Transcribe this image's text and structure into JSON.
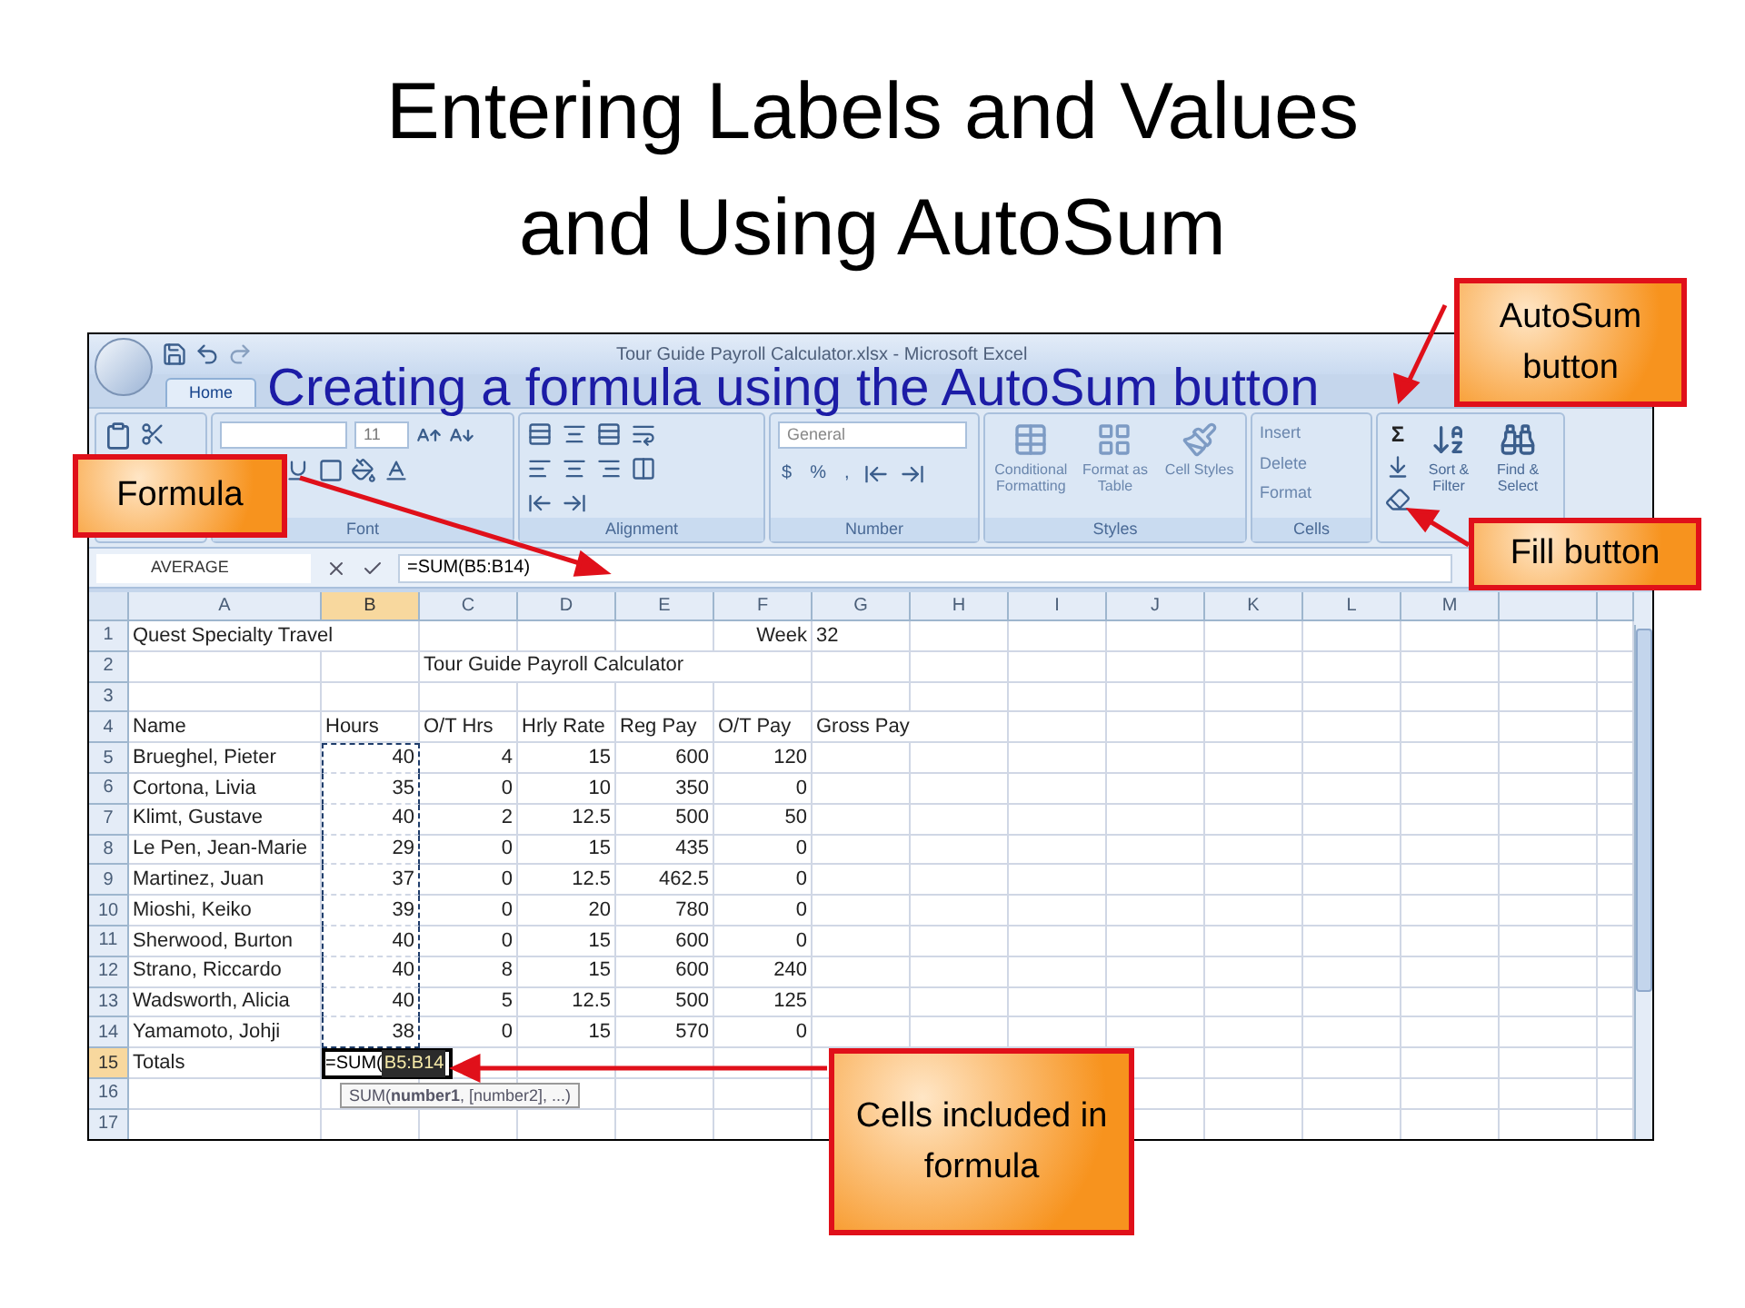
{
  "slide": {
    "title": "Entering Labels and Values\nand Using AutoSum",
    "subtitle": "Creating a formula using the AutoSum button"
  },
  "window": {
    "title": "Tour Guide Payroll Calculator.xlsx - Microsoft Excel"
  },
  "ribbon_tabs": [
    {
      "label": "Home",
      "selected": true
    }
  ],
  "ribbon": {
    "font": {
      "label": "Font",
      "size": "11"
    },
    "alignment": {
      "label": "Alignment"
    },
    "number": {
      "label": "Number",
      "format": "General",
      "buttons": [
        "$",
        "%",
        ","
      ]
    },
    "styles": {
      "label": "Styles",
      "buttons": [
        "Conditional Formatting",
        "Format as Table",
        "Cell Styles"
      ]
    },
    "cells": {
      "label": "Cells",
      "buttons": [
        "Insert",
        "Delete",
        "Format"
      ]
    },
    "editing": {
      "autosum": "Σ",
      "buttons": [
        "Sort & Filter",
        "Find & Select"
      ]
    }
  },
  "formula_bar": {
    "name_box": "AVERAGE",
    "formula": "=SUM(B5:B14)"
  },
  "sheet": {
    "columns": [
      {
        "label": "A",
        "selected": false
      },
      {
        "label": "B",
        "selected": true
      },
      {
        "label": "C",
        "selected": false
      },
      {
        "label": "D",
        "selected": false
      },
      {
        "label": "E",
        "selected": false
      },
      {
        "label": "F",
        "selected": false
      },
      {
        "label": "G",
        "selected": false
      },
      {
        "label": "H",
        "selected": false
      },
      {
        "label": "I",
        "selected": false
      },
      {
        "label": "J",
        "selected": false
      },
      {
        "label": "K",
        "selected": false
      },
      {
        "label": "L",
        "selected": false
      },
      {
        "label": "M",
        "selected": false
      }
    ],
    "rows": [
      {
        "label": "1",
        "selected": false,
        "cells": [
          {
            "text": "Quest Specialty Travel"
          },
          {},
          {},
          {},
          {},
          {
            "text": "Week",
            "kind": "right"
          },
          {
            "text": "32"
          }
        ]
      },
      {
        "label": "2",
        "selected": false,
        "cells": [
          {},
          {},
          {
            "text": "Tour Guide Payroll Calculator"
          }
        ]
      },
      {
        "label": "3",
        "selected": false,
        "cells": []
      },
      {
        "label": "4",
        "selected": false,
        "cells": [
          {
            "text": "Name"
          },
          {
            "text": "Hours"
          },
          {
            "text": "O/T Hrs"
          },
          {
            "text": "Hrly Rate"
          },
          {
            "text": "Reg Pay"
          },
          {
            "text": "O/T Pay"
          },
          {
            "text": "Gross Pay"
          }
        ]
      },
      {
        "label": "5",
        "selected": false,
        "cells": [
          {
            "text": "Brueghel, Pieter"
          },
          {
            "text": "40",
            "kind": "right",
            "marked": true
          },
          {
            "text": "4",
            "kind": "right"
          },
          {
            "text": "15",
            "kind": "right"
          },
          {
            "text": "600",
            "kind": "right"
          },
          {
            "text": "120",
            "kind": "right"
          }
        ]
      },
      {
        "label": "6",
        "selected": false,
        "cells": [
          {
            "text": "Cortona, Livia"
          },
          {
            "text": "35",
            "kind": "right",
            "marked": true
          },
          {
            "text": "0",
            "kind": "right"
          },
          {
            "text": "10",
            "kind": "right"
          },
          {
            "text": "350",
            "kind": "right"
          },
          {
            "text": "0",
            "kind": "right"
          }
        ]
      },
      {
        "label": "7",
        "selected": false,
        "cells": [
          {
            "text": "Klimt, Gustave"
          },
          {
            "text": "40",
            "kind": "right",
            "marked": true
          },
          {
            "text": "2",
            "kind": "right"
          },
          {
            "text": "12.5",
            "kind": "right"
          },
          {
            "text": "500",
            "kind": "right"
          },
          {
            "text": "50",
            "kind": "right"
          }
        ]
      },
      {
        "label": "8",
        "selected": false,
        "cells": [
          {
            "text": "Le Pen, Jean-Marie"
          },
          {
            "text": "29",
            "kind": "right",
            "marked": true
          },
          {
            "text": "0",
            "kind": "right"
          },
          {
            "text": "15",
            "kind": "right"
          },
          {
            "text": "435",
            "kind": "right"
          },
          {
            "text": "0",
            "kind": "right"
          }
        ]
      },
      {
        "label": "9",
        "selected": false,
        "cells": [
          {
            "text": "Martinez, Juan"
          },
          {
            "text": "37",
            "kind": "right",
            "marked": true
          },
          {
            "text": "0",
            "kind": "right"
          },
          {
            "text": "12.5",
            "kind": "right"
          },
          {
            "text": "462.5",
            "kind": "right"
          },
          {
            "text": "0",
            "kind": "right"
          }
        ]
      },
      {
        "label": "10",
        "selected": false,
        "cells": [
          {
            "text": "Mioshi, Keiko"
          },
          {
            "text": "39",
            "kind": "right",
            "marked": true
          },
          {
            "text": "0",
            "kind": "right"
          },
          {
            "text": "20",
            "kind": "right"
          },
          {
            "text": "780",
            "kind": "right"
          },
          {
            "text": "0",
            "kind": "right"
          }
        ]
      },
      {
        "label": "11",
        "selected": false,
        "cells": [
          {
            "text": "Sherwood, Burton"
          },
          {
            "text": "40",
            "kind": "right",
            "marked": true
          },
          {
            "text": "0",
            "kind": "right"
          },
          {
            "text": "15",
            "kind": "right"
          },
          {
            "text": "600",
            "kind": "right"
          },
          {
            "text": "0",
            "kind": "right"
          }
        ]
      },
      {
        "label": "12",
        "selected": false,
        "cells": [
          {
            "text": "Strano, Riccardo"
          },
          {
            "text": "40",
            "kind": "right",
            "marked": true
          },
          {
            "text": "8",
            "kind": "right"
          },
          {
            "text": "15",
            "kind": "right"
          },
          {
            "text": "600",
            "kind": "right"
          },
          {
            "text": "240",
            "kind": "right"
          }
        ]
      },
      {
        "label": "13",
        "selected": false,
        "cells": [
          {
            "text": "Wadsworth, Alicia"
          },
          {
            "text": "40",
            "kind": "right",
            "marked": true
          },
          {
            "text": "5",
            "kind": "right"
          },
          {
            "text": "12.5",
            "kind": "right"
          },
          {
            "text": "500",
            "kind": "right"
          },
          {
            "text": "125",
            "kind": "right"
          }
        ]
      },
      {
        "label": "14",
        "selected": false,
        "cells": [
          {
            "text": "Yamamoto, Johji"
          },
          {
            "text": "38",
            "kind": "right",
            "marked": true
          },
          {
            "text": "0",
            "kind": "right"
          },
          {
            "text": "15",
            "kind": "right"
          },
          {
            "text": "570",
            "kind": "right"
          },
          {
            "text": "0",
            "kind": "right"
          }
        ]
      },
      {
        "label": "15",
        "selected": true,
        "cells": [
          {
            "text": "Totals"
          },
          {
            "kind": "editing",
            "text": "=SUM(",
            "range": "B5:B14",
            "tooltip": "SUM(**number1**, [number2], ...)"
          }
        ]
      },
      {
        "label": "16",
        "selected": false,
        "cells": []
      },
      {
        "label": "17",
        "selected": false,
        "cells": []
      }
    ]
  },
  "callouts": [
    {
      "text": "AutoSum button"
    },
    {
      "text": "Formula"
    },
    {
      "text": "Fill button"
    },
    {
      "text": "Cells included in formula"
    }
  ]
}
